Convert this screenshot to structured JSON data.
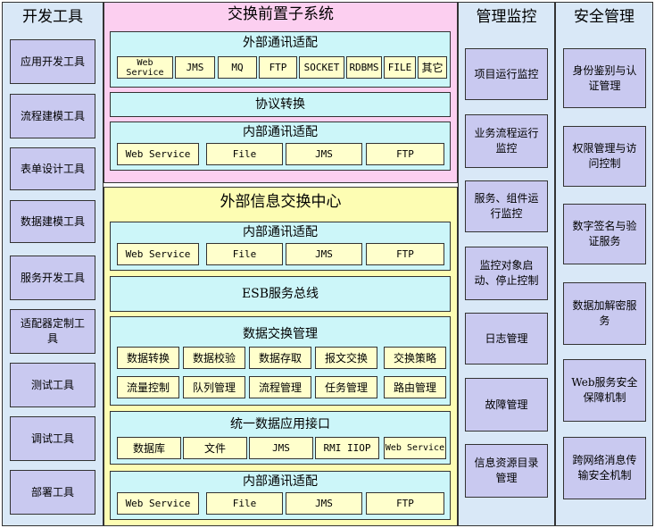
{
  "dev_tools": {
    "title": "开发工具",
    "items": [
      "应用开发工具",
      "流程建模工具",
      "表单设计工具",
      "数据建模工具",
      "服务开发工具",
      "适配器定制工具",
      "测试工具",
      "调试工具",
      "部署工具"
    ]
  },
  "front": {
    "title": "交换前置子系统",
    "external_adapter": {
      "title": "外部通讯适配",
      "items": [
        "Web Service",
        "JMS",
        "MQ",
        "FTP",
        "SOCKET",
        "RDBMS",
        "FILE",
        "其它"
      ]
    },
    "protocol": "协议转换",
    "internal_adapter": {
      "title": "内部通讯适配",
      "items": [
        "Web Service",
        "File",
        "JMS",
        "FTP"
      ]
    }
  },
  "center": {
    "title": "外部信息交换中心",
    "internal_adapter_top": {
      "title": "内部通讯适配",
      "items": [
        "Web Service",
        "File",
        "JMS",
        "FTP"
      ]
    },
    "esb": "ESB服务总线",
    "exchange_mgmt": {
      "title": "数据交换管理",
      "row1": [
        "数据转换",
        "数据校验",
        "数据存取",
        "报文交换",
        "交换策略"
      ],
      "row2": [
        "流量控制",
        "队列管理",
        "流程管理",
        "任务管理",
        "路由管理"
      ]
    },
    "unified_api": {
      "title": "统一数据应用接口",
      "items": [
        "数据库",
        "文件",
        "JMS",
        "RMI IIOP",
        "Web Service"
      ]
    },
    "internal_adapter_bottom": {
      "title": "内部通讯适配",
      "items": [
        "Web Service",
        "File",
        "JMS",
        "FTP"
      ]
    }
  },
  "monitor": {
    "title": "管理监控",
    "items": [
      "项目运行监控",
      "业务流程运行监控",
      "服务、组件运行监控",
      "监控对象启动、停止控制",
      "日志管理",
      "故障管理",
      "信息资源目录管理"
    ]
  },
  "security": {
    "title": "安全管理",
    "items": [
      "身份鉴别与认证管理",
      "权限管理与访问控制",
      "数字签名与验证服务",
      "数据加解密服务",
      "Web服务安全保障机制",
      "跨网络消息传输安全机制"
    ]
  },
  "colors": {
    "side_bg": "#d9e8f7",
    "side_box": "#c9c9f0",
    "front_bg": "#fccff0",
    "center_bg": "#fdfdb3",
    "cyan": "#ccf6f9",
    "cell": "#ffffcc"
  }
}
